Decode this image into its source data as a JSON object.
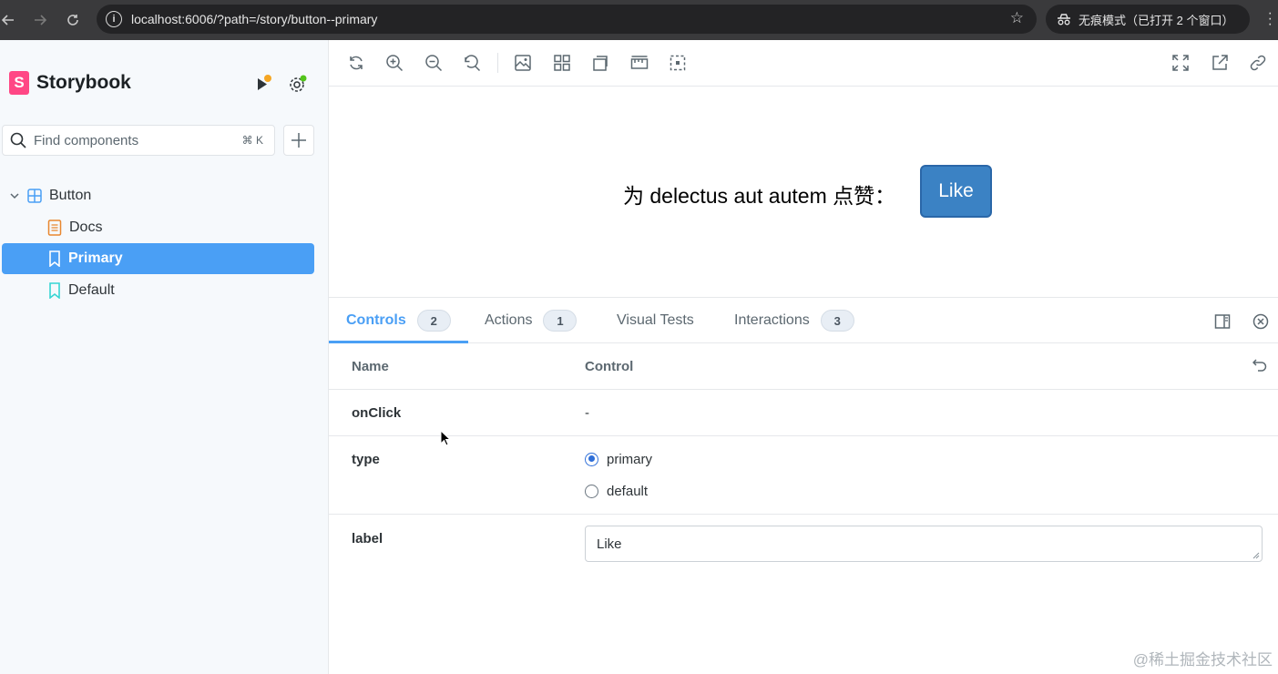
{
  "browser": {
    "url": "localhost:6006/?path=/story/button--primary",
    "incognito_label": "无痕模式（已打开 2 个窗口）"
  },
  "sidebar": {
    "brand": "Storybook",
    "search_placeholder": "Find components",
    "search_shortcut": "⌘ K",
    "tree": [
      {
        "label": "Button",
        "type": "component"
      },
      {
        "label": "Docs",
        "type": "docs"
      },
      {
        "label": "Primary",
        "type": "story",
        "selected": true
      },
      {
        "label": "Default",
        "type": "story"
      }
    ]
  },
  "canvas": {
    "preview_text": "为 delectus aut autem 点赞：",
    "button_label": "Like",
    "button_color": "#3b82c4"
  },
  "panel": {
    "tabs": [
      {
        "label": "Controls",
        "badge": "2",
        "active": true
      },
      {
        "label": "Actions",
        "badge": "1"
      },
      {
        "label": "Visual Tests",
        "badge": ""
      },
      {
        "label": "Interactions",
        "badge": "3"
      }
    ],
    "headers": {
      "name": "Name",
      "control": "Control"
    },
    "rows": {
      "onclick": {
        "name": "onClick",
        "value": "-"
      },
      "type": {
        "name": "type",
        "options": [
          "primary",
          "default"
        ],
        "selected": "primary"
      },
      "label": {
        "name": "label",
        "value": "Like"
      }
    }
  },
  "watermark": "@稀土掘金技术社区",
  "colors": {
    "accent": "#4a9ff5",
    "brand": "#ff4785"
  }
}
